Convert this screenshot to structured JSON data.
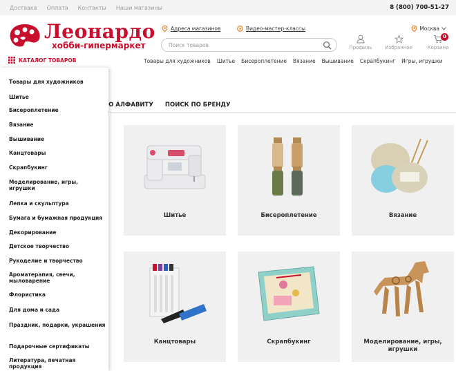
{
  "topbar": {
    "links": [
      "Доставка",
      "Оплата",
      "Контакты",
      "Наши магазины"
    ],
    "phone": "8 (800) 700-51-27"
  },
  "logo": {
    "name": "Леонардо",
    "tagline": "хобби-гипермаркет"
  },
  "header": {
    "store_address_link": "Адреса магазинов",
    "video_classes_link": "Видео-мастер-классы",
    "search_placeholder": "Поиск товаров",
    "city": "Москва",
    "profile_label": "Профиль",
    "favorites_label": "Избранное",
    "cart_label": "Корзина",
    "cart_count": "0"
  },
  "catalog_button": "КАТАЛОГ ТОВАРОВ",
  "nav": [
    "Товары для художников",
    "Шитье",
    "Бисероплетение",
    "Вязание",
    "Вышивание",
    "Скрапбукинг",
    "Игры, игрушки"
  ],
  "side_menu": [
    "Товары для художников",
    "Шитье",
    "Бисероплетение",
    "Вязание",
    "Вышивание",
    "Канцтовары",
    "Скрапбукинг",
    "Моделирование, игры, игрушки",
    "Лепка и скульптура",
    "Бумага и бумажная продукция",
    "Декорирование",
    "Детское творчество",
    "Рукоделие и творчество",
    "Ароматерапия, свечи, мыловарение",
    "Флористика",
    "Для дома и сада",
    "Праздник, подарки, украшения",
    "Подарочные сертификаты",
    "Литература, печатная продукция"
  ],
  "tabs": [
    "ПО АЛФАВИТУ",
    "ПОИСК ПО БРЕНДУ"
  ],
  "cards": [
    "Шитье",
    "Бисероплетение",
    "Вязание",
    "Канцтовары",
    "Скрапбукинг",
    "Моделирование, игры, игрушки"
  ],
  "colors": {
    "brand": "#c8102e",
    "card_bg": "#f0f0f0",
    "link_orange": "#e8740c"
  }
}
